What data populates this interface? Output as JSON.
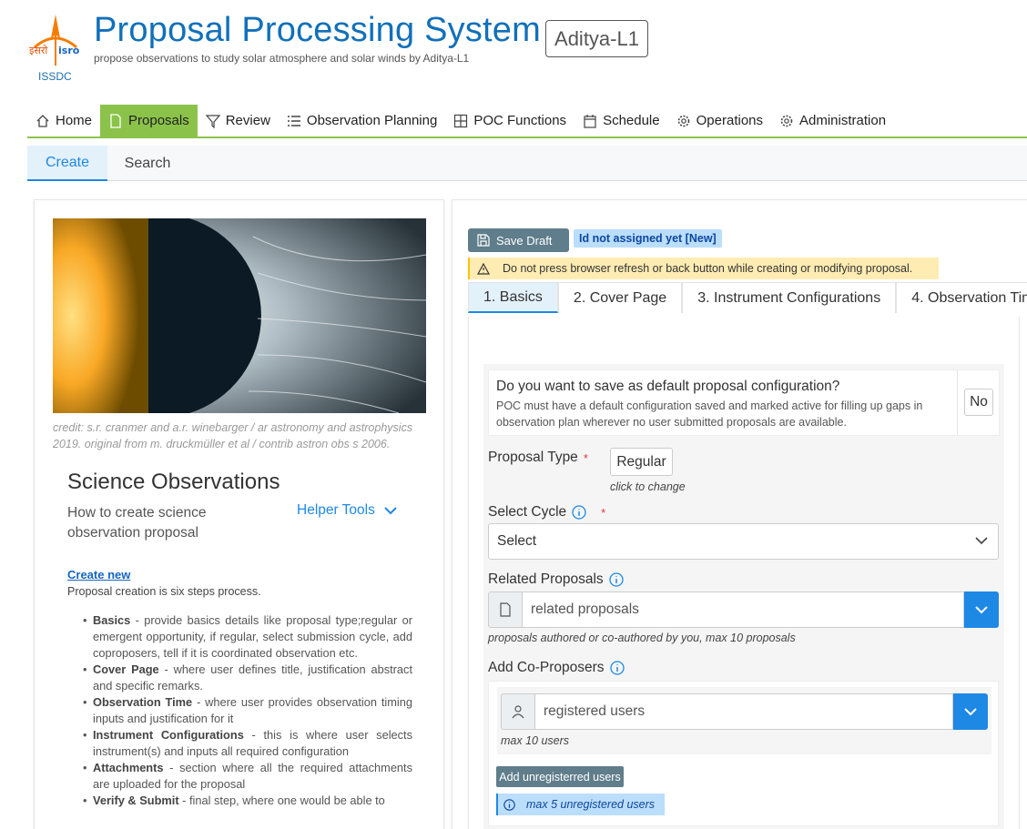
{
  "header": {
    "logo_label": "ISSDC",
    "title": "Proposal Processing System",
    "badge": "Aditya-L1",
    "subtitle": "propose observations to study solar atmosphere and solar winds by Aditya-L1"
  },
  "mainnav": {
    "items": [
      {
        "label": "Home",
        "icon": "home-icon"
      },
      {
        "label": "Proposals",
        "icon": "file-icon",
        "active": true
      },
      {
        "label": "Review",
        "icon": "filter-icon"
      },
      {
        "label": "Observation Planning",
        "icon": "list-icon"
      },
      {
        "label": "POC Functions",
        "icon": "grid-icon"
      },
      {
        "label": "Schedule",
        "icon": "calendar-icon"
      },
      {
        "label": "Operations",
        "icon": "gear-icon"
      },
      {
        "label": "Administration",
        "icon": "gear-icon"
      }
    ],
    "active_color": "#8bc34a"
  },
  "subnav": {
    "tabs": [
      {
        "label": "Create",
        "active": true
      },
      {
        "label": "Search"
      }
    ]
  },
  "left": {
    "credit": "credit: s.r. cranmer and a.r. winebarger / ar astronomy and astrophysics 2019. original from m. druckmüller et al / contrib astron obs s 2006.",
    "title": "Science Observations",
    "subtitle": "How to create science observation proposal",
    "helper": "Helper Tools",
    "create_new": "Create new",
    "process_text": "Proposal creation is six steps process.",
    "steps": [
      {
        "name": "Basics",
        "sep": " - ",
        "desc": "provide basics details like proposal type;regular or emergent opportunity, if regular, select submission cycle, add coproposers, tell if it is coordinated observation etc."
      },
      {
        "name": "Cover Page",
        "sep": " - ",
        "desc": "where user defines title, justification abstract and specific remarks."
      },
      {
        "name": "Observation Time",
        "sep": " - ",
        "desc": "where user provides observation timing inputs and justification for it"
      },
      {
        "name": "Instrument Configurations",
        "sep": " - ",
        "desc": "this is where user selects instrument(s) and inputs all required configuration"
      },
      {
        "name": "Attachments",
        "sep": " - ",
        "desc": "section where all the required attachments are uploaded for the proposal"
      },
      {
        "name": "Verify & Submit",
        "sep": " - ",
        "desc": "final step, where one would be able to"
      }
    ]
  },
  "right": {
    "save_draft": "Save Draft",
    "id_status": "Id not assigned yet [New]",
    "warning": "Do not press browser refresh or back button while creating or modifying proposal.",
    "steptabs": [
      "1. Basics",
      "2. Cover Page",
      "3. Instrument Configurations",
      "4. Observation Tim"
    ],
    "default_cfg": {
      "question": "Do you want to save as default proposal configuration?",
      "note": "POC must have a default configuration saved and marked active for filling up gaps in observation plan wherever no user submitted proposals are available.",
      "value": "No"
    },
    "proposal_type": {
      "label": "Proposal Type",
      "required": "*",
      "value": "Regular",
      "hint": "click to change"
    },
    "cycle": {
      "label": "Select Cycle",
      "required": "*",
      "value": "Select"
    },
    "related": {
      "label": "Related Proposals",
      "placeholder": "related proposals",
      "hint": "proposals authored or co-authored by you, max 10 proposals"
    },
    "coproposers": {
      "label": "Add Co-Proposers",
      "placeholder": "registered users",
      "hint": "max 10 users",
      "add_unregistered": "Add unregisterred users",
      "unregistered_info": "max 5 unregistered users"
    },
    "accent": "#1e88e5"
  }
}
